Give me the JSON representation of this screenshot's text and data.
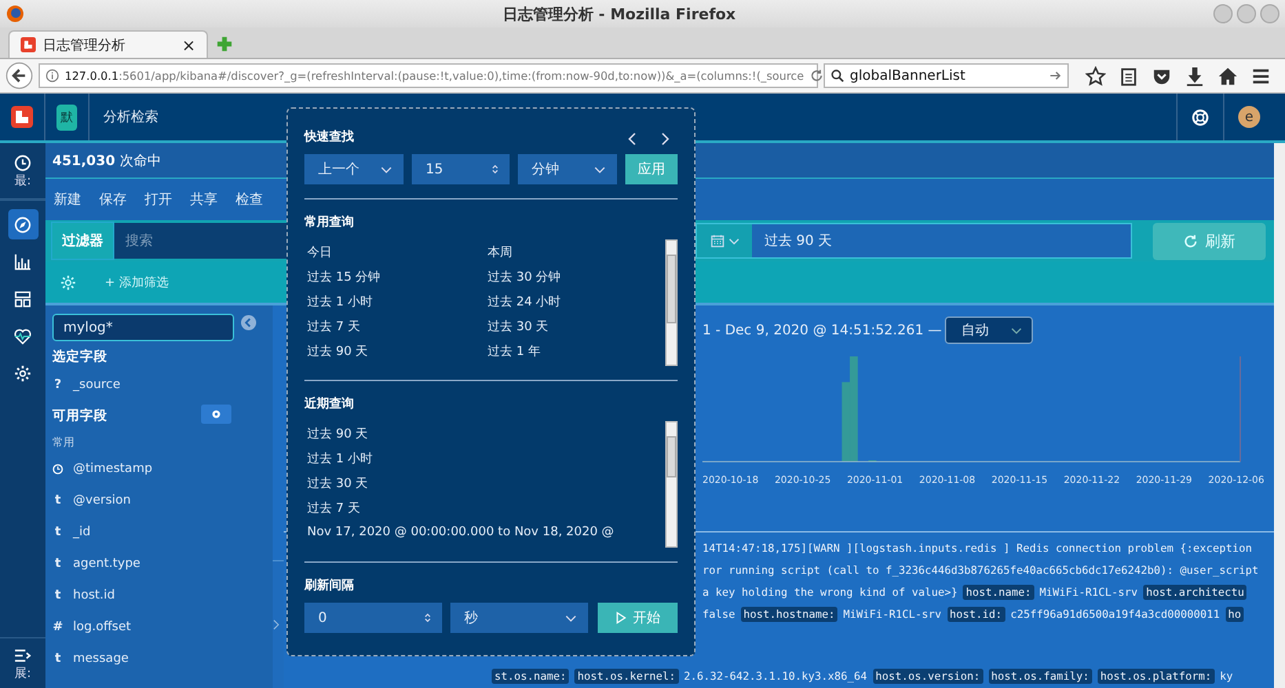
{
  "browser": {
    "window_title": "日志管理分析 - Mozilla Firefox",
    "tab": {
      "title": "日志管理分析",
      "close": "×",
      "selected": true
    },
    "url_host": "127.0.0.1",
    "url_rest": ":5601/app/kibana#/discover?_g=(refreshInterval:(pause:!t,value:0),time:(from:now-90d,to:now))&_a=(columns:!(_source",
    "search": {
      "value": "globalBannerList"
    }
  },
  "app": {
    "badge": "默",
    "title": "分析检索",
    "avatar": "e"
  },
  "side_nav": {
    "top_label": "最:",
    "bottom_label": "展:",
    "items": [
      {
        "kind": "compass",
        "selected": true
      },
      {
        "kind": "chart",
        "selected": false
      },
      {
        "kind": "dashboard",
        "selected": false
      },
      {
        "kind": "heartbeat",
        "selected": false
      },
      {
        "kind": "gear",
        "selected": false
      }
    ]
  },
  "hits": {
    "count": "451,030",
    "label": "次命中"
  },
  "menu": [
    "新建",
    "保存",
    "打开",
    "共享",
    "检查"
  ],
  "filter_bar": {
    "tab": "过滤器",
    "placeholder": "搜索",
    "add_filter": "+ 添加筛选",
    "date": "过去 90 天",
    "refresh": "刷新"
  },
  "fields": {
    "index_pattern": "mylog*",
    "selected_heading": "选定字段",
    "selected": [
      {
        "kind": "symbol",
        "symbol": "?",
        "name": "_source"
      }
    ],
    "available_heading": "可用字段",
    "group": "常用",
    "available": [
      {
        "kind": "clock",
        "name": "@timestamp"
      },
      {
        "kind": "symbol",
        "symbol": "t",
        "name": "@version"
      },
      {
        "kind": "symbol",
        "symbol": "t",
        "name": "_id"
      },
      {
        "kind": "symbol",
        "symbol": "t",
        "name": "agent.type"
      },
      {
        "kind": "symbol",
        "symbol": "t",
        "name": "host.id"
      },
      {
        "kind": "symbol",
        "symbol": "#",
        "name": "log.offset"
      },
      {
        "kind": "symbol",
        "symbol": "t",
        "name": "message"
      }
    ]
  },
  "chart": {
    "range": "1 - Dec 9, 2020 @ 14:51:52.261 —",
    "interval": "自动",
    "axis_labels": [
      "2020-10-18",
      "2020-10-25",
      "2020-11-01",
      "2020-11-08",
      "2020-11-15",
      "2020-11-22",
      "2020-11-29",
      "2020-12-06"
    ]
  },
  "log": {
    "lines": [
      [
        {
          "kind": "text",
          "text": "14T14:47:18,175][WARN ][logstash.inputs.redis ] Redis connection problem {:exception"
        }
      ],
      [
        {
          "kind": "text",
          "text": "ror running script (call to f_3236c446d3b876265fe40ac665cb6dc17e6242b0): @user_script"
        }
      ],
      [
        {
          "kind": "text",
          "text": "a key holding the wrong kind of value>}"
        },
        {
          "kind": "field",
          "text": "host.name:"
        },
        {
          "kind": "text",
          "text": "MiWiFi-R1CL-srv"
        },
        {
          "kind": "field",
          "text": "host.architectu"
        }
      ],
      [
        {
          "kind": "text",
          "text": "false"
        },
        {
          "kind": "field",
          "text": "host.hostname:"
        },
        {
          "kind": "text",
          "text": "MiWiFi-R1CL-srv"
        },
        {
          "kind": "field",
          "text": "host.id:"
        },
        {
          "kind": "text",
          "text": "c25ff96a91d6500a19f4a3cd00000011"
        },
        {
          "kind": "field",
          "text": "ho"
        }
      ]
    ],
    "field_row": [
      {
        "kind": "field",
        "text": "st.os.name:"
      },
      {
        "kind": "field",
        "text": "host.os.kernel:"
      },
      {
        "kind": "text",
        "text": "2.6.32-642.3.1.10.ky3.x86_64"
      },
      {
        "kind": "field",
        "text": "host.os.version:"
      },
      {
        "kind": "field",
        "text": "host.os.family:"
      },
      {
        "kind": "field",
        "text": "host.os.platform:"
      },
      {
        "kind": "text",
        "text": "ky"
      }
    ]
  },
  "popover": {
    "quick": {
      "title": "快速查找",
      "direction": "上一个",
      "amount": "15",
      "unit": "分钟",
      "apply": "应用"
    },
    "common": {
      "title": "常用查询",
      "items": [
        "今日",
        "本周",
        "过去 15 分钟",
        "过去 30 分钟",
        "过去 1 小时",
        "过去 24 小时",
        "过去 7 天",
        "过去 30 天",
        "过去 90 天",
        "过去 1 年"
      ]
    },
    "recent": {
      "title": "近期查询",
      "items": [
        "过去 90 天",
        "过去 1 小时",
        "过去 30 天",
        "过去 7 天",
        "Nov 17, 2020 @ 00:00:00.000 to Nov 18, 2020 @"
      ]
    },
    "refresh": {
      "title": "刷新间隔",
      "value": "0",
      "unit": "秒",
      "start": "开始"
    }
  }
}
